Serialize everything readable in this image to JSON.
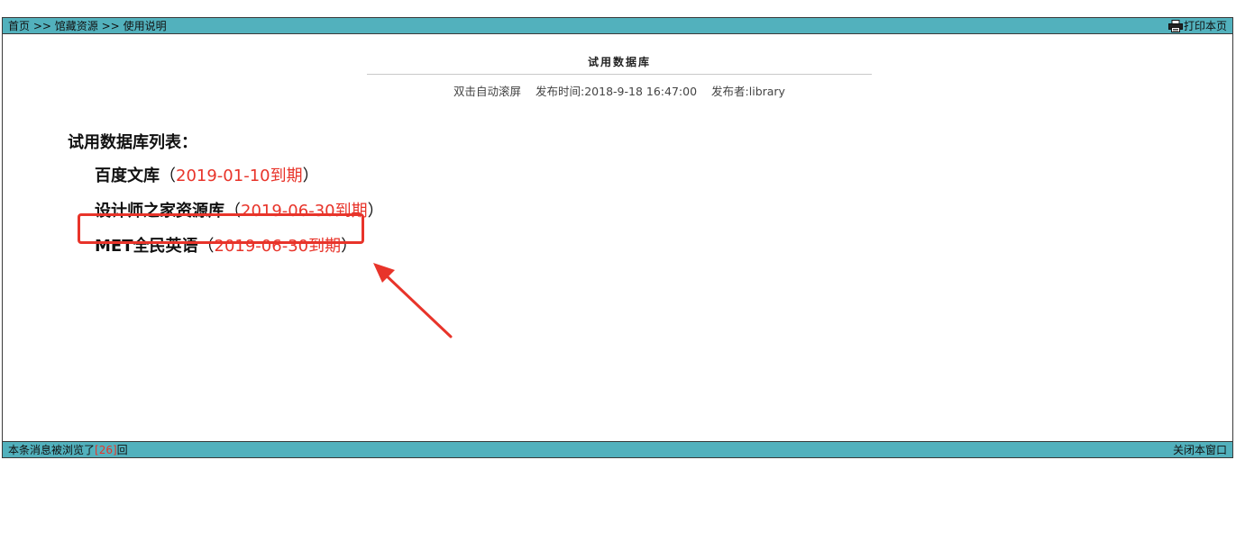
{
  "breadcrumb": {
    "home": "首页",
    "separator": ">>",
    "section": "馆藏资源",
    "current": "使用说明"
  },
  "toolbar": {
    "print_label": "打印本页",
    "print_icon": "printer-icon"
  },
  "article": {
    "title": "试用数据库",
    "scroll_hint": "双击自动滚屏",
    "publish_time": "发布时间:2018-9-18 16:47:00",
    "publisher": "发布者:library"
  },
  "content": {
    "heading": "试用数据库列表：",
    "open_paren": "（",
    "close_paren": "）",
    "items": [
      {
        "name": "百度文库",
        "expiry": "2019-01-10到期"
      },
      {
        "name": "设计师之家资源库",
        "expiry": "2019-06-30到期"
      },
      {
        "name": "MET全民英语",
        "expiry": "2019-06-30到期"
      }
    ]
  },
  "annotation": {
    "color": "#e8342a",
    "arrow_icon": "red-arrow-icon"
  },
  "footer": {
    "views_prefix": "本条消息被浏览了",
    "views_bracket_open": "[",
    "views_count": "26",
    "views_bracket_close": "]",
    "views_suffix": "回",
    "close_label": "关闭本窗口"
  },
  "colors": {
    "bar": "#52b1bd",
    "accent": "#e8342a",
    "border": "#3a3a3a"
  }
}
